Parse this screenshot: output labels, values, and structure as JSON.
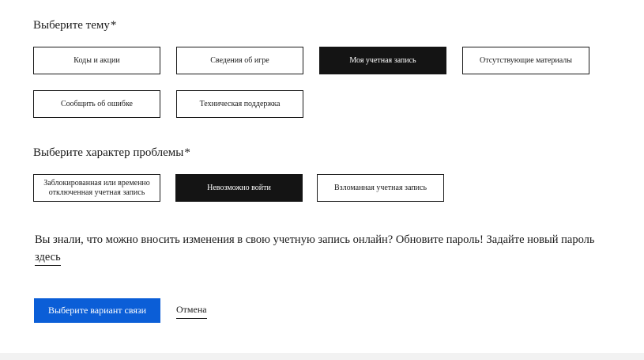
{
  "topic": {
    "title": "Выберите тему",
    "required_mark": "*",
    "options": [
      {
        "label": "Коды и акции",
        "selected": false
      },
      {
        "label": "Сведения об игре",
        "selected": false
      },
      {
        "label": "Моя учетная запись",
        "selected": true
      },
      {
        "label": "Отсутствующие материалы",
        "selected": false
      },
      {
        "label": "Сообщить об ошибке",
        "selected": false
      },
      {
        "label": "Техническая поддержка",
        "selected": false
      }
    ]
  },
  "problem": {
    "title": "Выберите характер проблемы",
    "required_mark": "*",
    "options": [
      {
        "label": "Заблокированная или временно отключенная учетная запись",
        "selected": false
      },
      {
        "label": "Невозможно войти",
        "selected": true
      },
      {
        "label": "Взломанная учетная запись",
        "selected": false
      }
    ]
  },
  "info": {
    "text": "Вы знали, что можно вносить изменения в свою учетную запись онлайн? Обновите пароль! Задайте новый пароль ",
    "link": "здесь"
  },
  "actions": {
    "primary_label": "Выберите вариант связи",
    "cancel_label": "Отмена"
  },
  "colors": {
    "primary": "#0b5ed7",
    "selected": "#141414"
  }
}
